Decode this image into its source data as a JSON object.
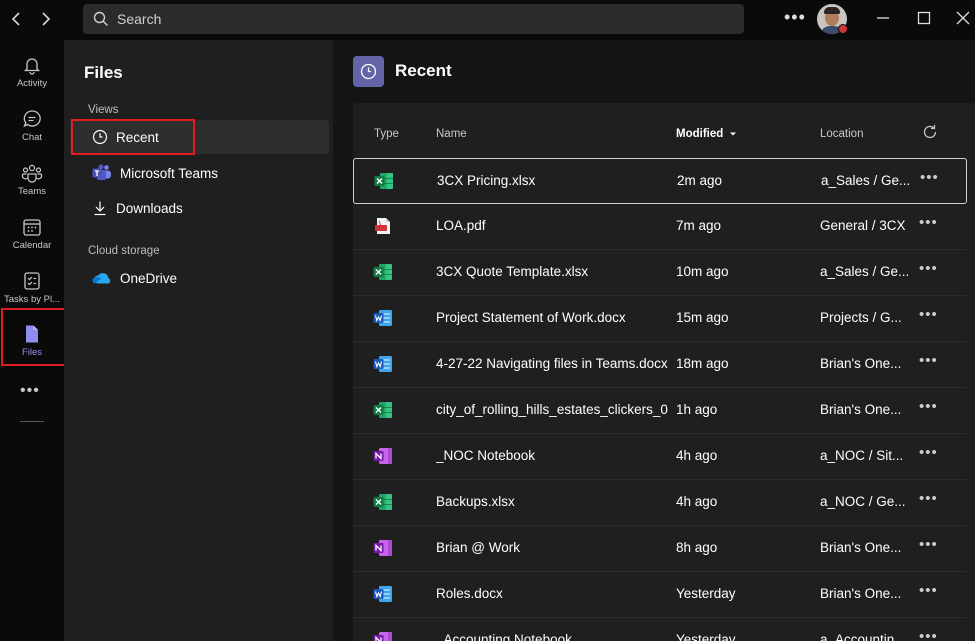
{
  "search": {
    "placeholder": "Search"
  },
  "rail": {
    "items": [
      {
        "label": "Activity",
        "icon": "bell-icon"
      },
      {
        "label": "Chat",
        "icon": "chat-icon"
      },
      {
        "label": "Teams",
        "icon": "teams-icon"
      },
      {
        "label": "Calendar",
        "icon": "calendar-icon"
      },
      {
        "label": "Tasks by Pl...",
        "icon": "tasks-icon"
      },
      {
        "label": "Files",
        "icon": "file-icon"
      }
    ],
    "active": "Files",
    "accent_color": "#8c8ff0"
  },
  "files_panel": {
    "title": "Files",
    "views_label": "Views",
    "views": [
      {
        "label": "Recent",
        "icon": "clock-icon"
      },
      {
        "label": "Microsoft Teams",
        "icon": "teams-logo-icon"
      },
      {
        "label": "Downloads",
        "icon": "download-icon"
      }
    ],
    "cloud_label": "Cloud storage",
    "cloud": [
      {
        "label": "OneDrive",
        "icon": "onedrive-icon"
      }
    ]
  },
  "main": {
    "title": "Recent",
    "columns": {
      "type": "Type",
      "name": "Name",
      "modified": "Modified",
      "location": "Location"
    },
    "rows": [
      {
        "type": "excel",
        "name": "3CX Pricing.xlsx",
        "modified": "2m ago",
        "location": "a_Sales / Ge..."
      },
      {
        "type": "pdf",
        "name": "LOA.pdf",
        "modified": "7m ago",
        "location": "General / 3CX"
      },
      {
        "type": "excel",
        "name": "3CX Quote Template.xlsx",
        "modified": "10m ago",
        "location": "a_Sales / Ge..."
      },
      {
        "type": "word",
        "name": "Project Statement of Work.docx",
        "modified": "15m ago",
        "location": "Projects / G..."
      },
      {
        "type": "word",
        "name": "4-27-22 Navigating files in Teams.docx",
        "modified": "18m ago",
        "location": "Brian's One..."
      },
      {
        "type": "excel",
        "name": "city_of_rolling_hills_estates_clickers_0...",
        "modified": "1h ago",
        "location": "Brian's One..."
      },
      {
        "type": "onenote",
        "name": "_NOC Notebook",
        "modified": "4h ago",
        "location": "a_NOC / Sit..."
      },
      {
        "type": "excel",
        "name": "Backups.xlsx",
        "modified": "4h ago",
        "location": "a_NOC / Ge..."
      },
      {
        "type": "onenote",
        "name": "Brian @ Work",
        "modified": "8h ago",
        "location": "Brian's One..."
      },
      {
        "type": "word",
        "name": "Roles.docx",
        "modified": "Yesterday",
        "location": "Brian's One..."
      },
      {
        "type": "onenote",
        "name": "_Accounting Notebook",
        "modified": "Yesterday",
        "location": "a_Accountin..."
      }
    ]
  },
  "colors": {
    "brand": "#6264a7",
    "highlight_box": "#e11d1d",
    "excel": "#21a366",
    "word": "#2b7cd3",
    "onenote": "#7719aa",
    "pdf": "#d13438"
  }
}
